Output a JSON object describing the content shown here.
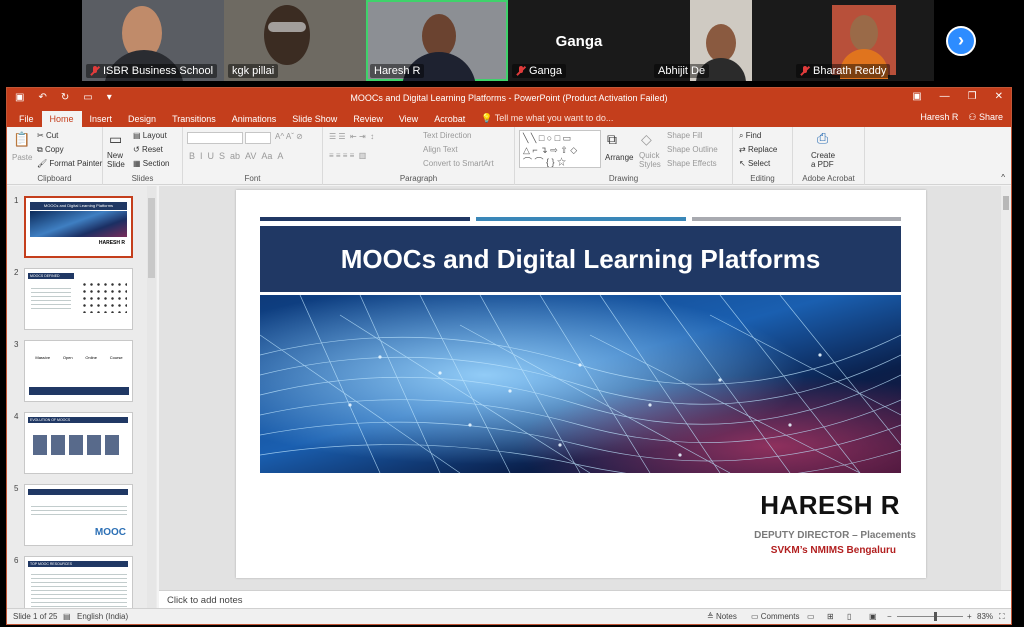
{
  "meeting": {
    "participants": [
      {
        "name": "ISBR Business School",
        "muted": true,
        "video": true
      },
      {
        "name": "kgk pillai",
        "muted": false,
        "video": true
      },
      {
        "name": "Haresh R",
        "muted": false,
        "video": true,
        "active_speaker": true
      },
      {
        "name": "Ganga",
        "muted": true,
        "video": false,
        "big_name": "Ganga"
      },
      {
        "name": "Abhijit De",
        "muted": false,
        "video": true
      },
      {
        "name": "Bharath Reddy",
        "muted": true,
        "video": true
      }
    ],
    "next_icon": "chevron-right-icon"
  },
  "ppt": {
    "window_title": "MOOCs and Digital Learning Platforms - PowerPoint (Product Activation Failed)",
    "user": "Haresh R",
    "share": "Share",
    "tabs": [
      "File",
      "Home",
      "Insert",
      "Design",
      "Transitions",
      "Animations",
      "Slide Show",
      "Review",
      "View",
      "Acrobat"
    ],
    "selected_tab": "Home",
    "tell_me": "Tell me what you want to do...",
    "ribbon": {
      "clipboard": {
        "label": "Clipboard",
        "paste": "Paste",
        "cut": "Cut",
        "copy": "Copy",
        "format_painter": "Format Painter"
      },
      "slides": {
        "label": "Slides",
        "new_slide": "New",
        "new_slide2": "Slide",
        "layout": "Layout",
        "reset": "Reset",
        "section": "Section"
      },
      "font": {
        "label": "Font"
      },
      "paragraph": {
        "label": "Paragraph",
        "text_direction": "Text Direction",
        "align_text": "Align Text",
        "convert": "Convert to SmartArt"
      },
      "drawing": {
        "label": "Drawing",
        "arrange": "Arrange",
        "quick_styles": "Quick",
        "quick_styles2": "Styles",
        "shape_fill": "Shape Fill",
        "shape_outline": "Shape Outline",
        "shape_effects": "Shape Effects"
      },
      "editing": {
        "label": "Editing",
        "find": "Find",
        "replace": "Replace",
        "select": "Select"
      },
      "acrobat": {
        "label": "Adobe Acrobat",
        "create_pdf": "Create",
        "create_pdf2": "a PDF"
      }
    },
    "thumbnails": [
      {
        "num": "1",
        "title": "MOOCs and Digital Learning Platforms",
        "name": "HARESH R"
      },
      {
        "num": "2",
        "title": "MOOCS DEFINED"
      },
      {
        "num": "3",
        "labels": [
          "Massive",
          "Open",
          "Online",
          "Course"
        ]
      },
      {
        "num": "4",
        "title": "EVOLUTION OF MOOCS"
      },
      {
        "num": "5",
        "logo": "MOOC"
      },
      {
        "num": "6",
        "title": "TOP MOOC RESOURCES"
      }
    ],
    "slide": {
      "title": "MOOCs and Digital Learning Platforms",
      "presenter": "HARESH R",
      "role": "DEPUTY DIRECTOR – Placements",
      "org": "SVKM’s NMIMS Bengaluru",
      "bar_colors": [
        "#203864",
        "#3a87b8",
        "#a8aab0"
      ]
    },
    "notes_placeholder": "Click to add notes",
    "status": {
      "slide_of": "Slide 1 of 25",
      "language": "English (India)",
      "notes": "Notes",
      "comments": "Comments",
      "zoom": "83%"
    }
  }
}
